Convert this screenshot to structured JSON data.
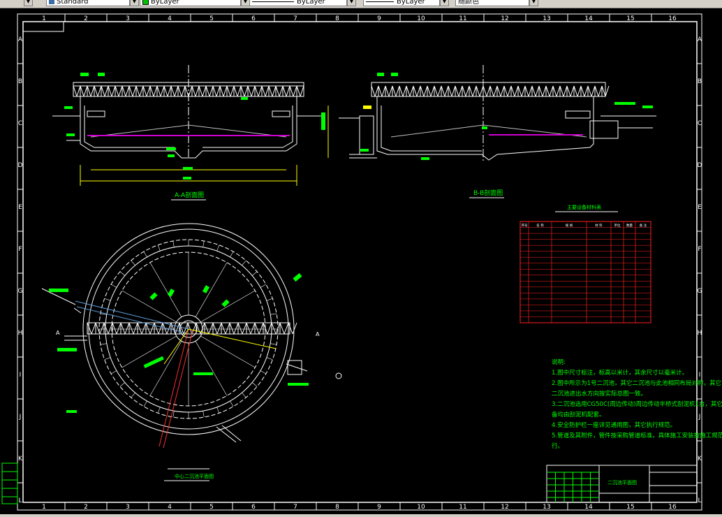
{
  "toolbar": {
    "text_style": "Standard",
    "layer": "ByLayer",
    "linetype": "ByLayer",
    "lineweight": "ByLayer",
    "color": "随颜色"
  },
  "frame": {
    "columns": [
      "1",
      "2",
      "3",
      "4",
      "5",
      "6",
      "7",
      "8",
      "9",
      "10",
      "11",
      "12",
      "13",
      "14",
      "15",
      "16"
    ],
    "rows": [
      "A",
      "B",
      "C",
      "D",
      "E",
      "F",
      "G",
      "H",
      "I",
      "J",
      "K",
      "L"
    ]
  },
  "section_titles": {
    "aa": "A-A剖面图",
    "bb": "B-B剖面图",
    "plan": "中心二沉池平面图"
  },
  "table": {
    "title": "主要设备材料表",
    "headers": [
      "序号",
      "名 称",
      "规 格",
      "材 料",
      "单位",
      "数量",
      "备 注"
    ]
  },
  "notes": {
    "heading": "说明:",
    "lines": [
      "1.图中尺寸标注，标高以米计，其余尺寸以毫米计。",
      "2.图中所示为1号二沉池，其它二沉池与此池相同布局对称，其它",
      "  二沉池进出水方向按实际总图一致。",
      "3.二沉池选用CG50C(周边传动)周边传动半桥式刮泥机1台，其它设",
      "  备均由刮泥机配套。",
      "4.安全防护栏一座详见通用图，其它执行规范。",
      "5.管道及其附件，管件按采购管道标准，具体施工安装按施工规范执",
      "  行。"
    ]
  },
  "title_block": {
    "drawing_name": "二沉池平面图"
  }
}
